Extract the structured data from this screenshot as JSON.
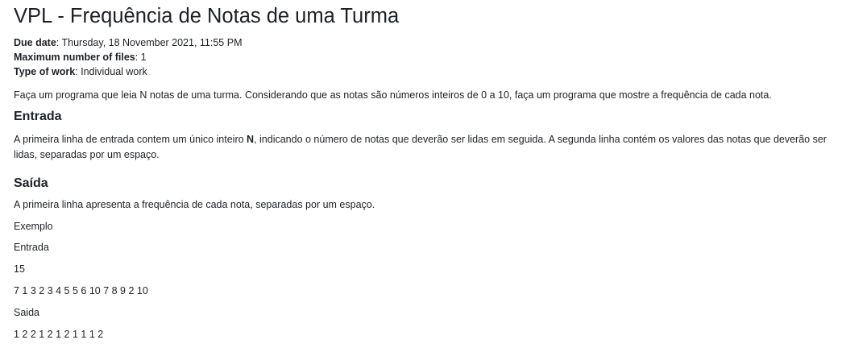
{
  "page_title": "VPL - Frequência de Notas de uma Turma",
  "meta": {
    "due_date_label": "Due date",
    "due_date_value": ": Thursday, 18 November 2021, 11:55 PM",
    "max_files_label": "Maximum number of files",
    "max_files_value": ": 1",
    "type_of_work_label": "Type of work",
    "type_of_work_value": ": Individual work"
  },
  "description": {
    "intro": "Faça um programa que leia N notas de uma turma. Considerando que as notas são números inteiros de 0 a 10, faça um programa que mostre a frequência de cada nota.",
    "entrada_heading": "Entrada",
    "entrada_text_1": "A primeira linha de entrada contem um único inteiro ",
    "entrada_text_bold": "N",
    "entrada_text_2": ", indicando o número de notas que deverão ser lidas em seguida. A segunda linha contém os valores das notas que deverão ser",
    "entrada_text_3": "lidas, separadas por um espaço.",
    "saida_heading": "Saída",
    "saida_text": "A primeira linha apresenta a frequência de cada nota, separadas por um espaço.",
    "exemplo_label": "Exemplo",
    "entrada_label": "Entrada",
    "example_n": "15",
    "example_notes": "7 1 3 2 3 4 5 5 6 10 7 8 9 2 10",
    "saida_label": "Saida",
    "example_output": "1 2 2 1 2 1 2 1 1 1 2"
  }
}
